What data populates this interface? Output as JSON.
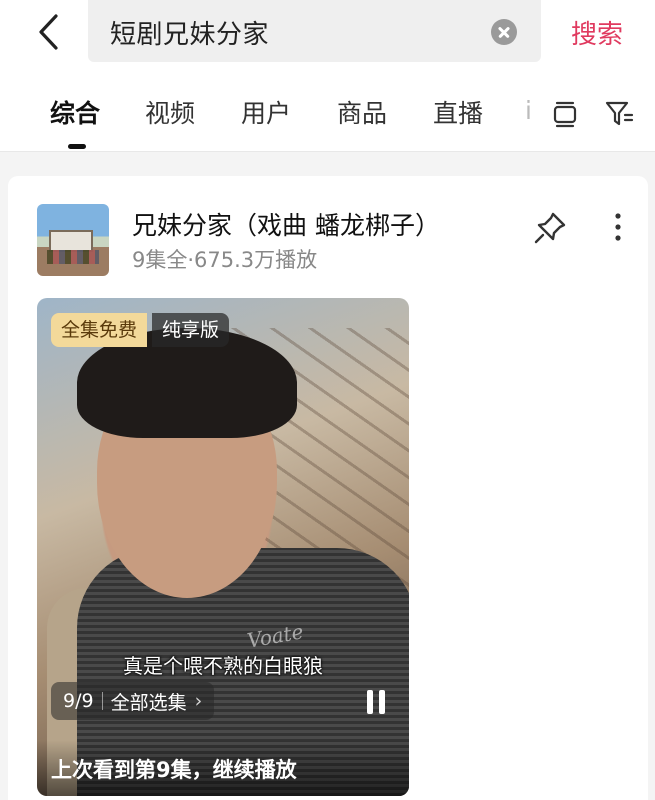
{
  "search": {
    "query": "短剧兄妹分家",
    "button_label": "搜索"
  },
  "tabs": [
    {
      "label": "综合",
      "active": true
    },
    {
      "label": "视频"
    },
    {
      "label": "用户"
    },
    {
      "label": "商品"
    },
    {
      "label": "直播"
    }
  ],
  "tab_overflow_hint": "i",
  "icons": {
    "back": "chevron-left-icon",
    "clear": "clear-icon",
    "layout": "layout-toggle-icon",
    "filter": "filter-icon",
    "pin": "pin-icon",
    "more": "more-vertical-icon",
    "pause": "pause-icon"
  },
  "result": {
    "title": "兄妹分家（戏曲 蟠龙梆子）",
    "meta": "9集全·675.3万播放",
    "video": {
      "badge_free": "全集免费",
      "badge_pure": "纯享版",
      "subtitle": "真是个喂不熟的白眼狼",
      "watermark": "Voate",
      "episode_progress": "9/9",
      "episode_select_label": "全部选集",
      "chevron": "›",
      "resume_text": "上次看到第9集，继续播放"
    }
  },
  "colors": {
    "accent": "#e03a5f",
    "badge_gold": "#f3d99a"
  }
}
